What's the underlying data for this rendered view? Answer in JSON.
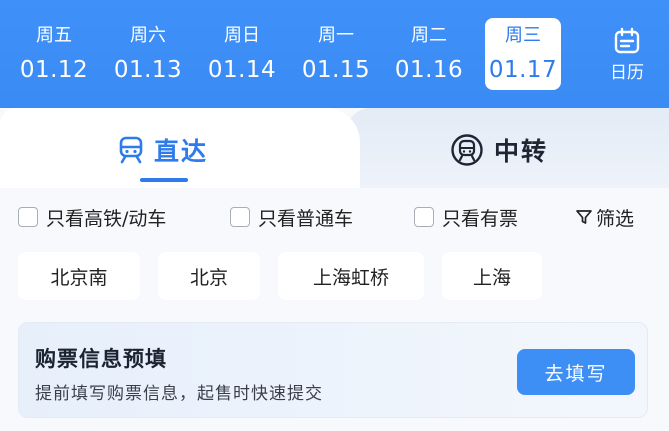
{
  "dates": [
    {
      "weekday": "周五",
      "date": "01.12"
    },
    {
      "weekday": "周六",
      "date": "01.13"
    },
    {
      "weekday": "周日",
      "date": "01.14"
    },
    {
      "weekday": "周一",
      "date": "01.15"
    },
    {
      "weekday": "周二",
      "date": "01.16"
    },
    {
      "weekday": "周三",
      "date": "01.17",
      "selected": true
    }
  ],
  "calendar": {
    "label": "日历",
    "icon": "calendar-icon"
  },
  "tabs": {
    "direct": {
      "label": "直达",
      "icon": "train-icon",
      "active": true
    },
    "transfer": {
      "label": "中转",
      "icon": "transfer-train-icon"
    }
  },
  "filters": {
    "high_speed_only": "只看高铁/动车",
    "regular_only": "只看普通车",
    "available_only": "只看有票",
    "filter_button": "筛选"
  },
  "stations": [
    "北京南",
    "北京",
    "上海虹桥",
    "上海"
  ],
  "prefill": {
    "title": "购票信息预填",
    "subtitle": "提前填写购票信息，起售时快速提交",
    "button": "去填写"
  },
  "colors": {
    "accent": "#2d7bec",
    "header_bg": "#3b8cf6",
    "button_bg": "#3d8ef5"
  }
}
